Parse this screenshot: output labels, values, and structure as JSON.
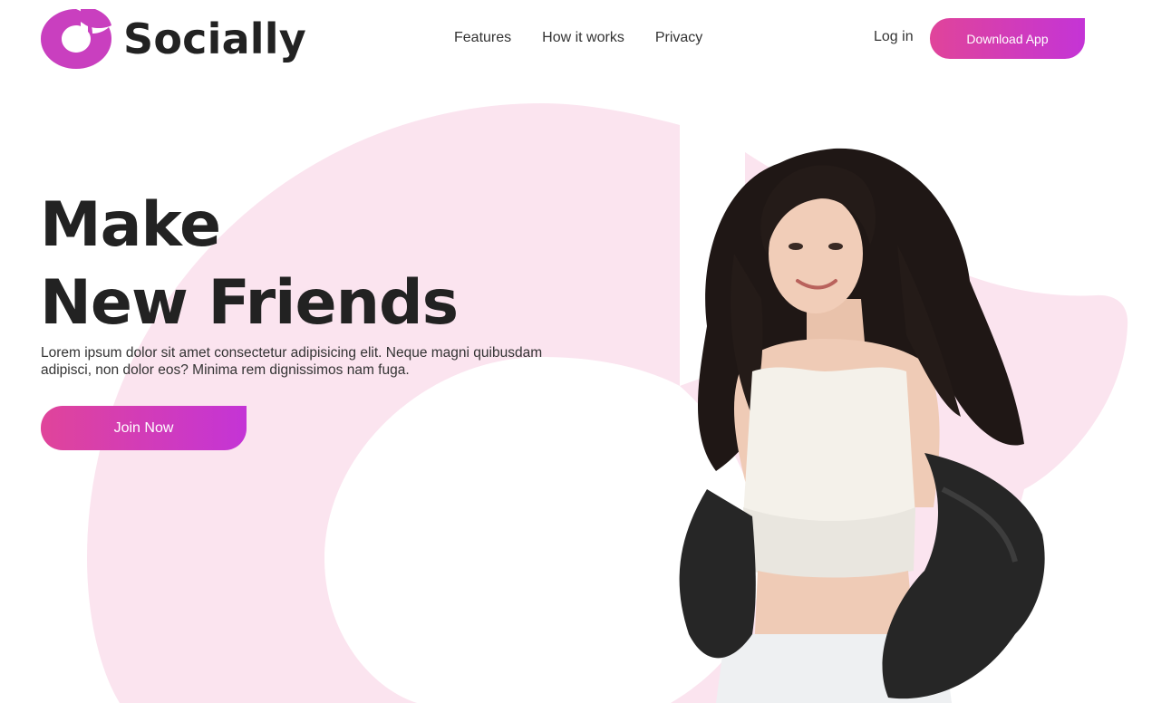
{
  "brand": {
    "name": "Socially",
    "logo_icon": "socially-logo-icon",
    "accent_gradient": [
      "#e0449a",
      "#c434d6"
    ],
    "bg_shape_color": "#fbe4ef"
  },
  "nav": {
    "items": [
      {
        "label": "Features"
      },
      {
        "label": "How it works"
      },
      {
        "label": "Privacy"
      }
    ],
    "login_label": "Log in",
    "download_label": "Download App"
  },
  "hero": {
    "title_line1": "Make",
    "title_line2": "New Friends",
    "description": "Lorem ipsum dolor sit amet consectetur adipisicing elit. Neque magni quibusdam adipisci, non dolor eos? Minima rem dignissimos nam fuga.",
    "cta_label": "Join Now",
    "image": "woman-portrait-image"
  }
}
